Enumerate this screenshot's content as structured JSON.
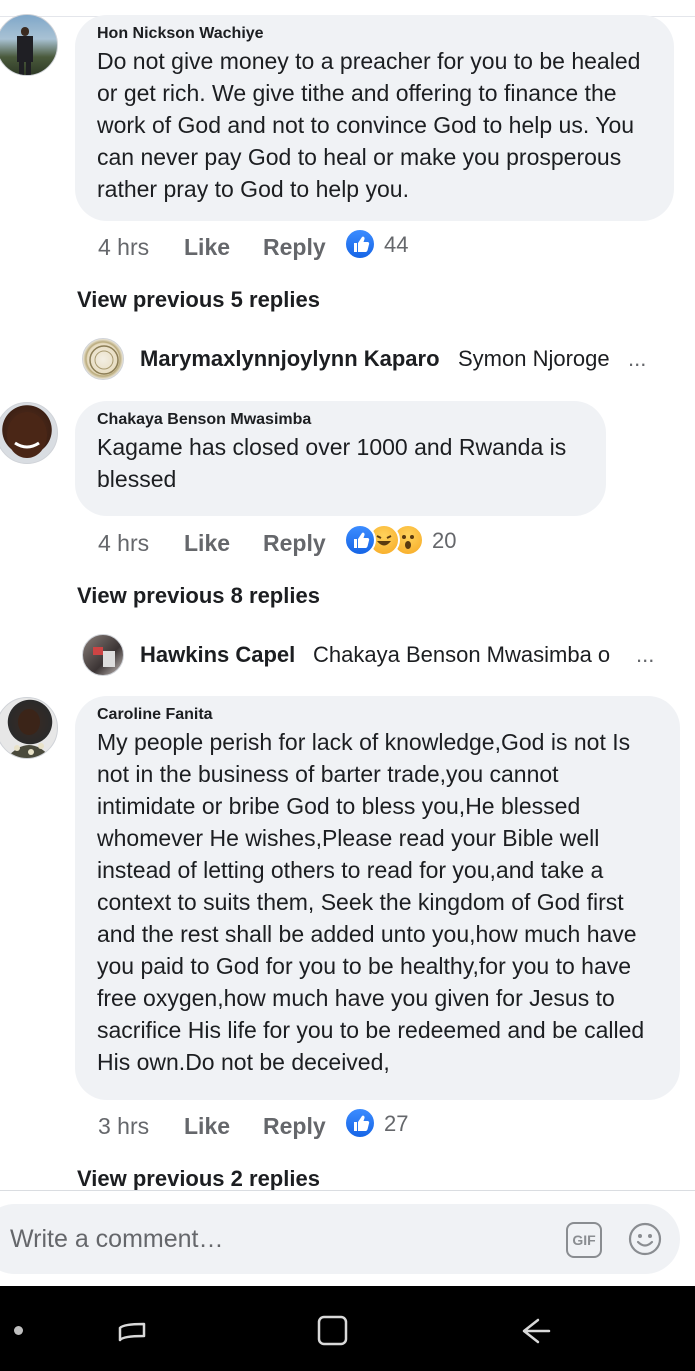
{
  "comments": [
    {
      "author": "Hon Nickson Wachiye",
      "text": "Do not give money to a preacher for you to be healed or get rich. We give tithe and offering to finance the work of God and not to convince God to help us. You can never pay God to heal or make you prosperous rather pray to God to help you.",
      "time": "4 hrs",
      "like_label": "Like",
      "reply_label": "Reply",
      "reaction_count": "44",
      "reactions": [
        "like"
      ],
      "view_previous": "View previous 5 replies",
      "latest_reply": {
        "author": "Marymaxlynnjoylynn Kaparo",
        "text": "Symon Njoroge",
        "ellipsis": "..."
      }
    },
    {
      "author": "Chakaya Benson Mwasimba",
      "text": "Kagame has closed over 1000 and Rwanda is blessed",
      "time": "4 hrs",
      "like_label": "Like",
      "reply_label": "Reply",
      "reaction_count": "20",
      "reactions": [
        "like",
        "laugh",
        "wow"
      ],
      "view_previous": "View previous 8 replies",
      "latest_reply": {
        "author": "Hawkins Capel",
        "text": "Chakaya Benson Mwasimba o",
        "ellipsis": "..."
      }
    },
    {
      "author": "Caroline Fanita",
      "text": "My people perish for lack of knowledge,God is not Is not in the business of barter trade,you cannot intimidate or bribe God to bless you,He blessed whomever He wishes,Please read your Bible well instead of letting others to read for you,and take a context to suits them, Seek the kingdom of God first and the rest shall be added unto you,how much have you paid to God for you to be healthy,for you to have free oxygen,how much have you given for Jesus to sacrifice His life for you to be redeemed and be called His own.Do not be deceived,",
      "time": "3 hrs",
      "like_label": "Like",
      "reply_label": "Reply",
      "reaction_count": "27",
      "reactions": [
        "like"
      ],
      "view_previous": "View previous 2 replies"
    }
  ],
  "composer": {
    "placeholder": "Write a comment…",
    "gif_label": "GIF",
    "emoji_icon": "smiley-icon"
  },
  "navbar": {
    "icons": [
      "dot-icon",
      "recent-apps-icon",
      "home-icon",
      "back-icon"
    ]
  },
  "colors": {
    "bubble": "#f0f2f5",
    "secondary_text": "#65676b",
    "like_blue": "#1877f2",
    "navbar": "#000000"
  }
}
